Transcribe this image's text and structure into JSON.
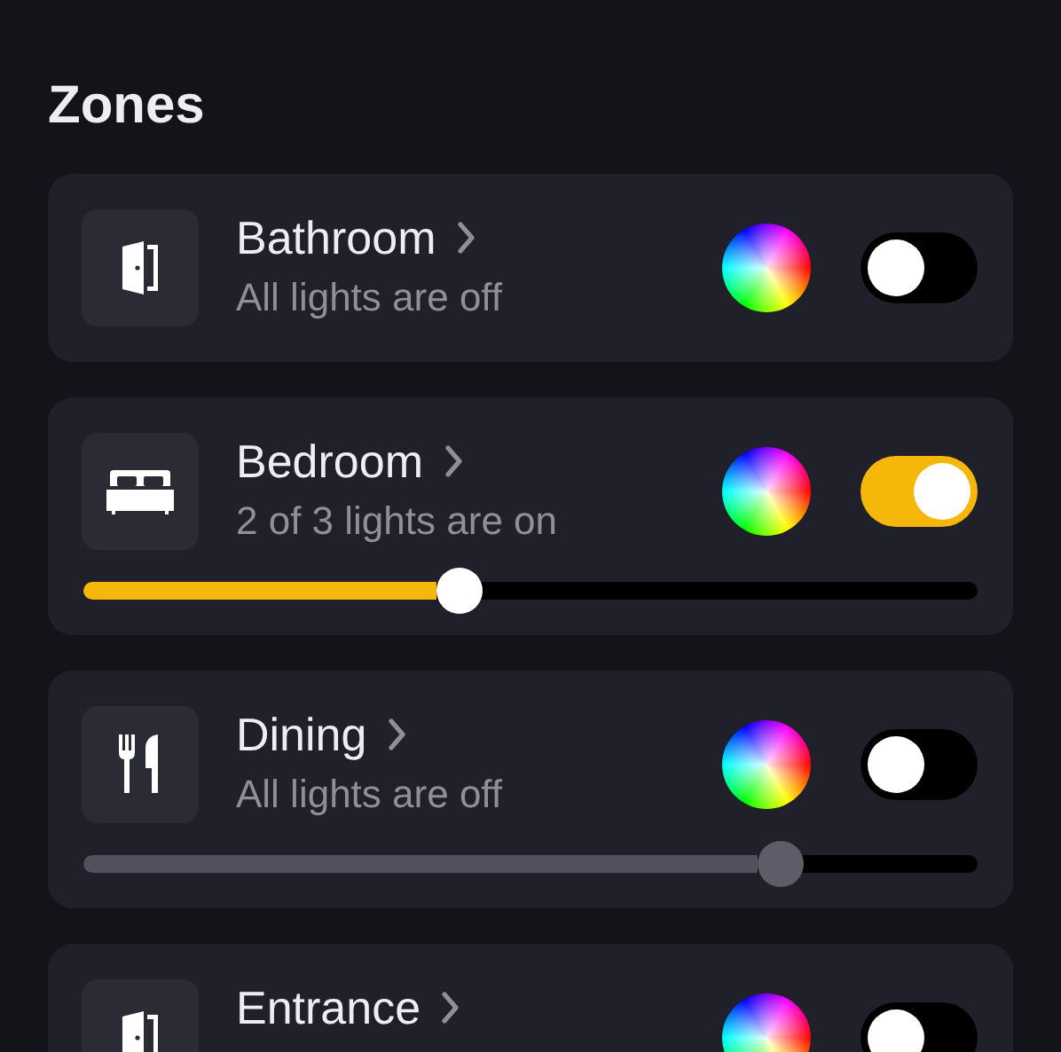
{
  "title": "Zones",
  "zones": [
    {
      "name": "Bathroom",
      "kind": "door",
      "status": "All lights are off",
      "on": false
    },
    {
      "name": "Bedroom",
      "kind": "bed",
      "status": "2 of 3 lights are on",
      "on": true,
      "level": 0.42
    },
    {
      "name": "Dining",
      "kind": "cutlery",
      "status": "All lights are off",
      "on": false,
      "level": 0.78
    },
    {
      "name": "Entrance",
      "kind": "door",
      "on": false
    }
  ]
}
